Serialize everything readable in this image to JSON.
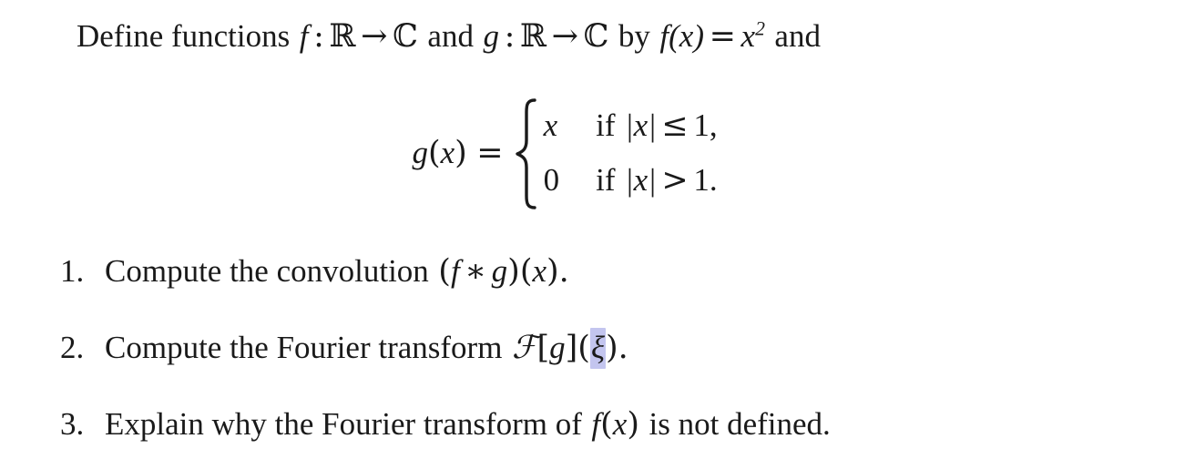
{
  "document": {
    "type": "math-exercise",
    "background_color": "#ffffff",
    "text_color": "#1a1a1a",
    "selection_highlight_color": "#c3c5ef"
  },
  "intro": {
    "lead": "Define functions",
    "f_name": "f",
    "colon": ":",
    "domain": "ℝ",
    "arrow": "→",
    "codomain": "ℂ",
    "and_1": "and",
    "g_name": "g",
    "colon_2": ":",
    "domain_2": "ℝ",
    "arrow_2": "→",
    "codomain_2": "ℂ",
    "by": "by",
    "f_def_lhs": "f(x)",
    "equals": "=",
    "f_def_base": "x",
    "f_def_exponent": "2",
    "and_2": "and"
  },
  "equation": {
    "lhs_g": "g",
    "lhs_paren_open": "(",
    "lhs_var": "x",
    "lhs_paren_close": ")",
    "lhs_equals": "=",
    "cases": [
      {
        "value": "x",
        "condition_if": "if",
        "condition_expr": "|x|",
        "condition_relation": "≤",
        "condition_bound": "1",
        "punctuation": ","
      },
      {
        "value": "0",
        "condition_if": "if",
        "condition_expr": "|x|",
        "condition_relation": ">",
        "condition_bound": "1",
        "punctuation": "."
      }
    ]
  },
  "questions": [
    {
      "number": "1.",
      "text_before": "Compute the convolution",
      "expr_open": "(",
      "expr_f": "f",
      "expr_operator": "∗",
      "expr_g": "g",
      "expr_close": ")(",
      "expr_var": "x",
      "expr_end": ").",
      "highlighted": null
    },
    {
      "number": "2.",
      "text_before": "Compute the Fourier transform",
      "expr_script": "ℱ",
      "expr_bracket_open": "[",
      "expr_g": "g",
      "expr_bracket_close": "]",
      "expr_paren_open": "(",
      "highlighted": "ξ",
      "expr_end": ").",
      "selection_note": "xi is selected/highlighted"
    },
    {
      "number": "3.",
      "text_before": "Explain why the Fourier transform of",
      "expr_f": "f",
      "expr_paren_open": "(",
      "expr_var": "x",
      "expr_paren_close": ")",
      "text_after": "is not defined.",
      "highlighted": null
    }
  ]
}
